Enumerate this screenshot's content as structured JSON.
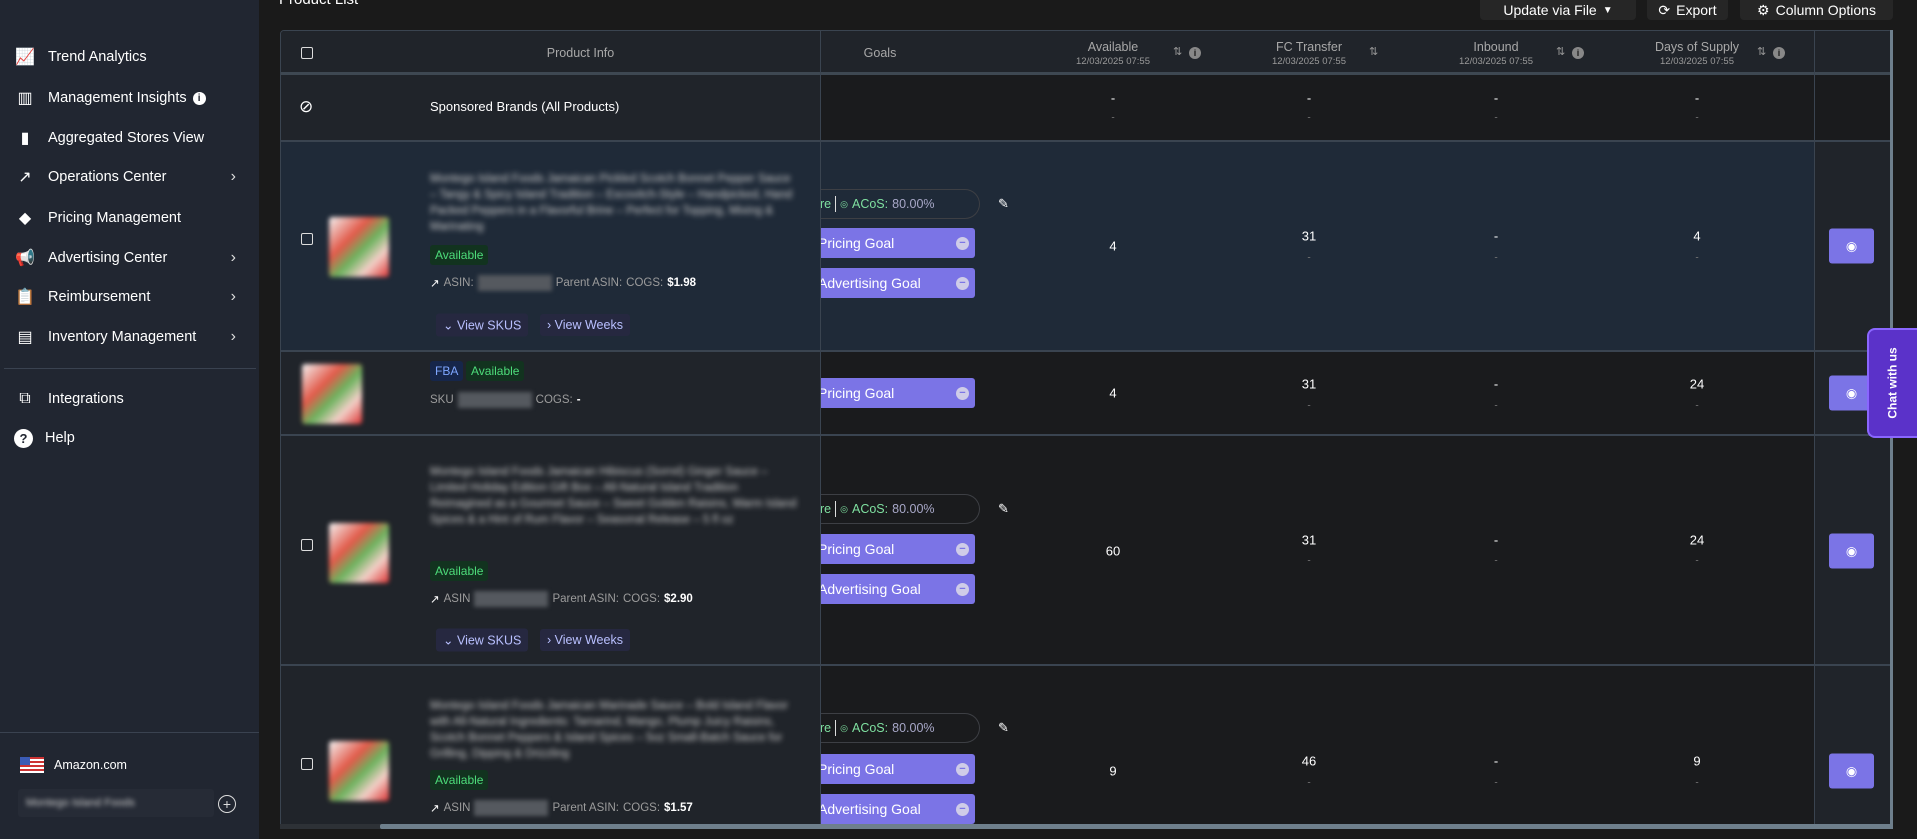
{
  "sidebar": {
    "items": [
      {
        "label": "Trend Analytics",
        "icon": "trend-chart-icon"
      },
      {
        "label": "Management Insights",
        "icon": "bar-chart-icon",
        "info": true
      },
      {
        "label": "Aggregated Stores View",
        "icon": "bars-icon"
      },
      {
        "label": "Operations Center",
        "icon": "trend-arrow-icon",
        "chevron": true
      },
      {
        "label": "Pricing Management",
        "icon": "tag-icon"
      },
      {
        "label": "Advertising Center",
        "icon": "megaphone-icon",
        "chevron": true
      },
      {
        "label": "Reimbursement",
        "icon": "clipboard-check-icon",
        "chevron": true
      },
      {
        "label": "Inventory Management",
        "icon": "archive-icon",
        "chevron": true
      }
    ],
    "secondary": [
      {
        "label": "Integrations",
        "icon": "integrations-icon"
      },
      {
        "label": "Help",
        "icon": "help-icon"
      }
    ],
    "marketplace": "Amazon.com",
    "store": "Montego Island Foods"
  },
  "page": {
    "title": "Product List"
  },
  "toolbar": {
    "update": "Update via File",
    "export": "Export",
    "columns": "Column Options"
  },
  "table": {
    "headers": {
      "product": "Product Info",
      "goals": "Goals"
    },
    "metric_columns": [
      {
        "label": "Available",
        "date": "12/03/2025 07:55",
        "info": true
      },
      {
        "label": "FC Transfer",
        "date": "12/03/2025 07:55",
        "info": false
      },
      {
        "label": "Inbound",
        "date": "12/03/2025 07:55",
        "info": true
      },
      {
        "label": "Days of Supply",
        "date": "12/03/2025 07:55",
        "info": true
      }
    ],
    "sponsored": {
      "label": "Sponsored Brands (All Products)",
      "values": [
        "-",
        "-",
        "-",
        "-"
      ],
      "subs": [
        "-",
        "-",
        "-",
        "-"
      ]
    },
    "rows": [
      {
        "type": "product",
        "title": "Montego Island Foods Jamaican Pickled Scotch Bonnet Pepper Sauce – Tangy & Spicy Island Tradition – Escovitch-Style – Handpicked, Hand Packed Peppers in a Flavorful Brine – Perfect for Topping, Mixing & Marinating",
        "status": "Available",
        "asin_label": "ASIN:",
        "parent_label": "Parent ASIN:",
        "cogs_label": "COGS:",
        "cogs": "$1.98",
        "goal_fragment": "re",
        "acos_label": "ACoS:",
        "acos": "80.00%",
        "pricing_goal": "Pricing Goal",
        "advertising_goal": "Advertising Goal",
        "view_skus": "View SKUS",
        "view_weeks": "View Weeks",
        "values": [
          "4",
          "31",
          "-",
          "4"
        ],
        "subs": [
          "",
          "-",
          "-",
          "-"
        ]
      },
      {
        "type": "sku",
        "channel": "FBA",
        "status": "Available",
        "sku_label": "SKU",
        "cogs_label": "COGS:",
        "cogs": "-",
        "pricing_goal": "Pricing Goal",
        "values": [
          "4",
          "31",
          "-",
          "24"
        ],
        "subs": [
          "",
          "-",
          "-",
          "-"
        ]
      },
      {
        "type": "product",
        "title": "Montego Island Foods Jamaican Hibiscus (Sorrel) Ginger Sauce – Limited Holiday Edition Gift Box – All-Natural Island Tradition Reimagined as a Gourmet Sauce – Sweet Golden Raisins, Warm Island Spices & a Hint of Rum Flavor – Seasonal Release – 5 fl oz",
        "status": "Available",
        "asin_label": "ASIN",
        "parent_label": "Parent ASIN:",
        "cogs_label": "COGS:",
        "cogs": "$2.90",
        "goal_fragment": "re",
        "acos_label": "ACoS:",
        "acos": "80.00%",
        "pricing_goal": "Pricing Goal",
        "advertising_goal": "Advertising Goal",
        "view_skus": "View SKUS",
        "view_weeks": "View Weeks",
        "values": [
          "60",
          "31",
          "-",
          "24"
        ],
        "subs": [
          "",
          "-",
          "-",
          "-"
        ]
      },
      {
        "type": "product",
        "title": "Montego Island Foods Jamaican Marinade Sauce – Bold Island Flavor with All-Natural Ingredients: Tamarind, Mango, Plump Juicy Raisins, Scotch Bonnet Peppers & Island Spices – 5oz Small-Batch Sauce for Grilling, Dipping & Drizzling",
        "status": "Available",
        "asin_label": "ASIN",
        "parent_label": "Parent ASIN:",
        "cogs_label": "COGS:",
        "cogs": "$1.57",
        "goal_fragment": "re",
        "acos_label": "ACoS:",
        "acos": "80.00%",
        "pricing_goal": "Pricing Goal",
        "advertising_goal": "Advertising Goal",
        "values": [
          "9",
          "46",
          "-",
          "9"
        ],
        "subs": [
          "",
          "-",
          "-",
          "-"
        ]
      }
    ]
  },
  "chat": {
    "label": "Chat with us"
  },
  "colors": {
    "accent": "#7b74e6",
    "available_green": "#4ddc7a",
    "sidebar_bg": "#212631",
    "chat_purple": "#5b32c9"
  }
}
